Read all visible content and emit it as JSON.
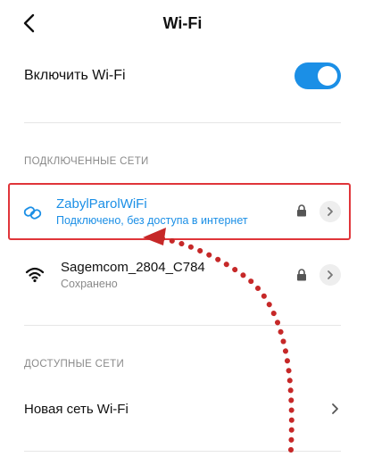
{
  "header": {
    "title": "Wi-Fi",
    "back_icon": "back-arrow-icon"
  },
  "wifi_toggle": {
    "label": "Включить Wi-Fi",
    "state": "on",
    "accent_color": "#1b8fe6"
  },
  "connected_section": {
    "title": "ПОДКЛЮЧЕННЫЕ СЕТИ",
    "networks": [
      {
        "name": "ZabylParolWiFi",
        "status": "Подключено, без доступа в интернет",
        "icon": "link-icon",
        "locked": true,
        "text_color": "#1b8fe6",
        "highlight_color": "#e0353a"
      },
      {
        "name": "Sagemcom_2804_C784",
        "status": "Сохранено",
        "icon": "wifi-signal-icon",
        "locked": true
      }
    ]
  },
  "available_section": {
    "title": "ДОСТУПНЫЕ СЕТИ",
    "new_network_label": "Новая сеть Wi-Fi"
  },
  "annotation": {
    "arrow_color": "#c62828",
    "arrow_style": "dotted"
  }
}
